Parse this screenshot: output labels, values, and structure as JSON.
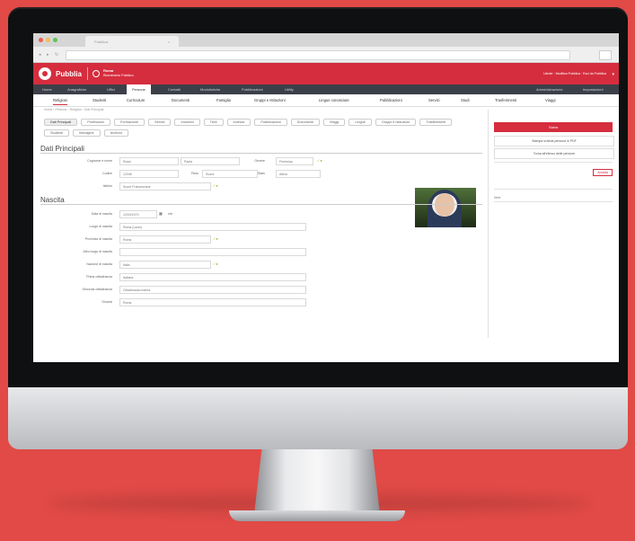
{
  "browser": {
    "tab_title": "Pubblica",
    "tab_close": "×"
  },
  "app": {
    "brand": "Pubblia",
    "context_title": "Roma",
    "context_sub": "Ricevimento Pubblico",
    "user": "Utente · Modifica Pubblica · Esci da Pubblica"
  },
  "nav_main": [
    "Home",
    "Anagrafiche",
    "Uffici",
    "Persone",
    "Contatti",
    "Modulistiche",
    "Pubblicazioni",
    "Utility",
    "Amministrazione",
    "Impostazioni"
  ],
  "nav_sub": [
    "Religiosi",
    "Studenti",
    "Curriculum",
    "Documenti",
    "Famiglia",
    "Gruppi e Istituzioni",
    "Lingue conosciute",
    "Pubblicazioni",
    "Servizi",
    "Studi",
    "Trasferimenti",
    "Viaggi"
  ],
  "breadcrumb": "Home › Persone › Religiosi › Dati Principali",
  "pills": [
    "Dati Principali",
    "Professioni",
    "Formazione",
    "Servizi",
    "Incarichi",
    "Titoli",
    "Indirizzi",
    "Pubblicazioni",
    "Documenti",
    "Viaggi",
    "Lingue",
    "Gruppi e Istituzioni",
    "Trasferimenti",
    "Studenti",
    "Immagine",
    "Archivio"
  ],
  "sec_main": "Dati Principali",
  "sec_birth": "Nascita",
  "rows_main": [
    {
      "label": "Cognome e nome",
      "v1": "Rossi",
      "v2": "Paola",
      "l3": "Genere",
      "v3": "Femmina"
    },
    {
      "label": "Codice",
      "v1": "12345",
      "l2": "Titolo",
      "v2": "Suora",
      "l3": "Stato",
      "v3": "Attiva"
    },
    {
      "label": "Istituto",
      "v1": "Suore Francescane"
    }
  ],
  "rows_birth": [
    {
      "label": "Data di nascita",
      "value": "12/03/1970",
      "extra": "età"
    },
    {
      "label": "Luogo di nascita",
      "value": "Roma (Lazio)"
    },
    {
      "label": "Provincia di nascita",
      "value": "Roma"
    },
    {
      "label": "Altro luogo di nascita",
      "value": ""
    },
    {
      "label": "Nazione di nascita",
      "value": "Italia"
    },
    {
      "label": "Prima cittadinanza",
      "value": "Italiana"
    },
    {
      "label": "Seconda cittadinanza",
      "value": "Cittadinanza estera"
    },
    {
      "label": "Diocesi",
      "value": "Roma"
    }
  ],
  "side": {
    "save": "Salva",
    "btn_print": "Stampa scheda persona in PDF",
    "btn_list": "Torna all'elenco delle persone",
    "cancel": "Annulla",
    "note": "Note"
  },
  "colors": {
    "brand": "#d52d3e",
    "background": "#e14a46"
  }
}
